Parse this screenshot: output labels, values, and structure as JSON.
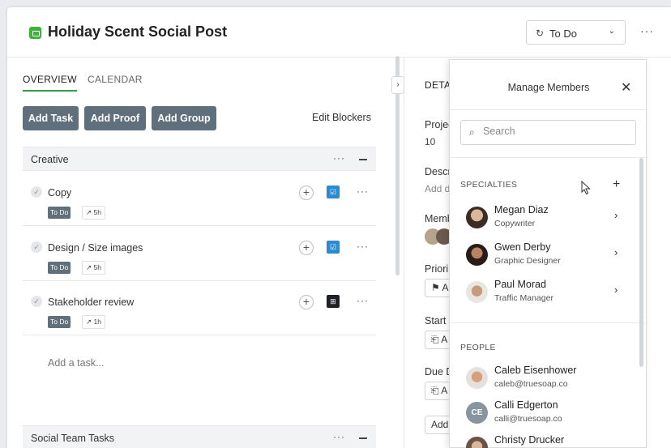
{
  "header": {
    "title": "Holiday Scent Social Post",
    "status_label": "To Do",
    "more_label": "···"
  },
  "tabs": [
    {
      "label": "OVERVIEW",
      "active": true
    },
    {
      "label": "CALENDAR",
      "active": false
    }
  ],
  "actions": {
    "add_task": "Add Task",
    "add_proof": "Add Proof",
    "add_group": "Add Group",
    "edit_blockers": "Edit Blockers"
  },
  "groups": [
    {
      "name": "Creative"
    },
    {
      "name": "Social Team Tasks"
    }
  ],
  "tasks": [
    {
      "name": "Copy",
      "status": "To Do",
      "estimate": "5h",
      "type_icon": "task-check-icon",
      "type_color": "#2b8ad0"
    },
    {
      "name": "Design / Size images",
      "status": "To Do",
      "estimate": "5h",
      "type_icon": "task-check-icon",
      "type_color": "#2b8ad0"
    },
    {
      "name": "Stakeholder review",
      "status": "To Do",
      "estimate": "1h",
      "type_icon": "proof-icon",
      "type_color": "#1e2226"
    }
  ],
  "add_task_placeholder": "Add a task...",
  "details": {
    "tab": "DETAI",
    "project_label": "Projec",
    "project_value": "10",
    "description_label": "Descr",
    "description_value": "Add d",
    "members_label": "Memb",
    "priority_label": "Priori",
    "priority_value": "A",
    "start_label": "Start",
    "start_value": "A",
    "due_label": "Due D",
    "due_value": "A",
    "add_label": "Add"
  },
  "members_popover": {
    "title": "Manage Members",
    "search_placeholder": "Search",
    "specialties_label": "SPECIALTIES",
    "people_label": "PEOPLE",
    "specialties": [
      {
        "name": "Megan Diaz",
        "role": "Copywriter"
      },
      {
        "name": "Gwen Derby",
        "role": "Graphic Designer"
      },
      {
        "name": "Paul Morad",
        "role": "Traffic Manager"
      }
    ],
    "people": [
      {
        "name": "Caleb Eisenhower",
        "email": "caleb@truesoap.co",
        "initials": ""
      },
      {
        "name": "Calli Edgerton",
        "email": "calli@truesoap.co",
        "initials": "CE"
      },
      {
        "name": "Christy Drucker",
        "email": "",
        "initials": ""
      }
    ]
  },
  "colors": {
    "accent_green": "#2e9b48",
    "button_slate": "#5f6f7b",
    "project_icon": "#3cb43c"
  }
}
